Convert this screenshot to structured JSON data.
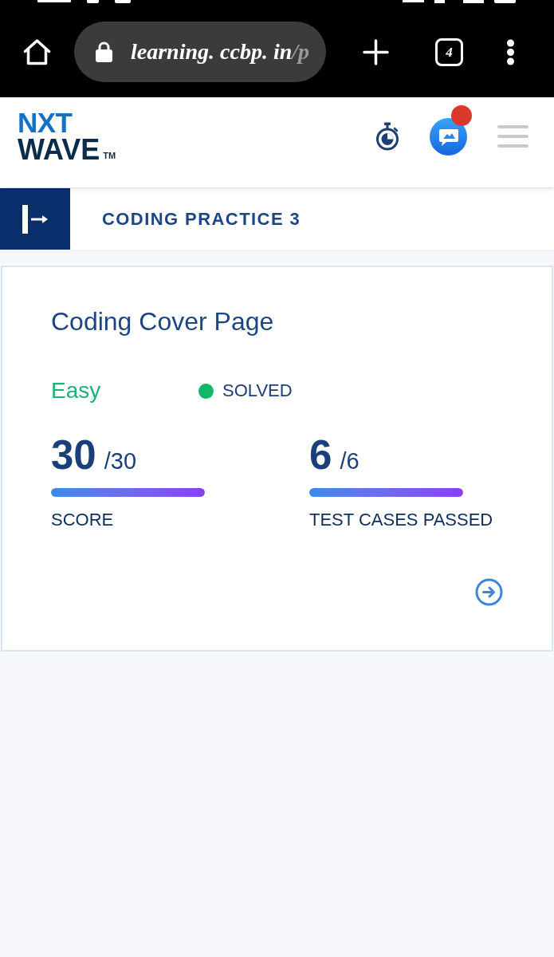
{
  "browser_bar": {
    "url_host": "learning. ccbp. in",
    "url_path": "/p",
    "tab_count": "4"
  },
  "header": {
    "logo": {
      "top_line": "NXT",
      "bottom_line": "WAVE",
      "trademark": "TM"
    },
    "chat_notification": true
  },
  "breadcrumb": {
    "title": "CODING PRACTICE 3"
  },
  "problem_card": {
    "title": "Coding Cover Page",
    "difficulty": {
      "kind": "easy",
      "label": "Easy"
    },
    "status": {
      "kind": "solved",
      "label": "SOLVED"
    },
    "stats": [
      {
        "value": "30",
        "total": "/30",
        "level": 1,
        "label": "SCORE"
      },
      {
        "value": "6",
        "total": "/6",
        "level": 1,
        "label": "TEST CASES PASSED"
      }
    ]
  }
}
